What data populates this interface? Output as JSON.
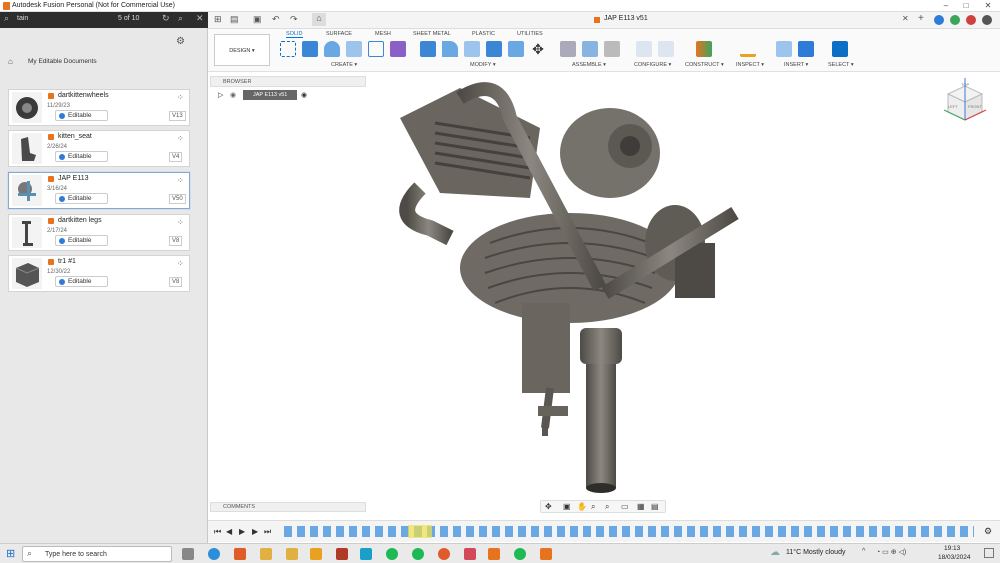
{
  "title_bar": {
    "title": "Autodesk Fusion Personal (Not for Commercial Use)",
    "minimize": "–",
    "maximize": "□",
    "close": "✕"
  },
  "left_panel": {
    "search_value": "tain",
    "result_count": "5 of 10",
    "breadcrumb": "My Editable Documents",
    "documents": [
      {
        "name": "dartkittenwheels",
        "date": "11/29/23",
        "status": "Editable",
        "version": "V13"
      },
      {
        "name": "kitten_seat",
        "date": "2/26/24",
        "status": "Editable",
        "version": "V4"
      },
      {
        "name": "JAP E113",
        "date": "3/16/24",
        "status": "Editable",
        "version": "V50"
      },
      {
        "name": "dartkitten legs",
        "date": "2/17/24",
        "status": "Editable",
        "version": "V8"
      },
      {
        "name": "tr1 #1",
        "date": "12/30/22",
        "status": "Editable",
        "version": "V8"
      }
    ]
  },
  "document_tab": {
    "title": "JAP E113 v51"
  },
  "ribbon": {
    "workspace": "DESIGN ▾",
    "tabs": [
      "SOLID",
      "SURFACE",
      "MESH",
      "SHEET METAL",
      "PLASTIC",
      "UTILITIES"
    ],
    "groups": [
      "CREATE ▾",
      "MODIFY ▾",
      "ASSEMBLE ▾",
      "CONFIGURE ▾",
      "CONSTRUCT ▾",
      "INSPECT ▾",
      "INSERT ▾",
      "SELECT ▾"
    ]
  },
  "browser": {
    "label": "BROWSER",
    "root": "JAP E113 v51"
  },
  "comments": {
    "label": "COMMENTS"
  },
  "viewcube": {
    "top": "TOP",
    "front": "FRONT",
    "left": "LEFT"
  },
  "taskbar": {
    "search_placeholder": "Type here to search",
    "weather": "11°C  Mostly cloudy",
    "time": "19:13",
    "date": "18/03/2024"
  },
  "colors": {
    "accent": "#0b6fc5",
    "brand": "#e8731f",
    "dark_bar": "#2d2d2d",
    "model": "#6e6a64"
  }
}
